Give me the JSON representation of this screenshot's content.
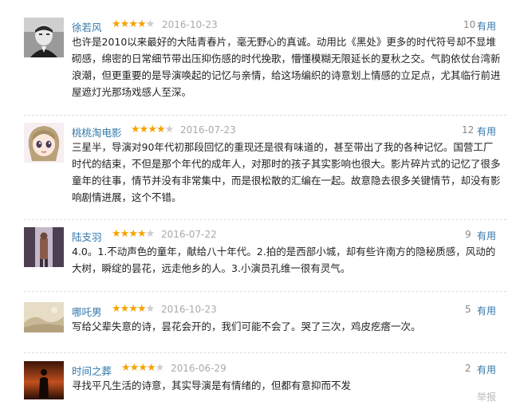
{
  "reviews": [
    {
      "author": "徐若风",
      "rating": 4,
      "date": "2016-10-23",
      "votes": "10",
      "useful_label": "有用",
      "text": "也许是2010以来最好的大陆青春片，毫无野心的真诚。动用比《黑处》更多的时代符号却不显堆砌感，绵密的日常细节带出压抑伤感的时代挽歌，懵懂模糊无限延长的夏秋之交。气韵依仗台湾新浪潮，但更重要的是导演唤起的记忆与亲情，给这场编织的诗意划上情感的立足点，尤其临行前进屋遮灯光那场戏感人至深。",
      "avatar_icon": "boy-portrait"
    },
    {
      "author": "桃桃淘电影",
      "rating": 4,
      "date": "2016-07-23",
      "votes": "12",
      "useful_label": "有用",
      "text": "三星半，导演对90年代初那段回忆的重现还是很有味道的，甚至带出了我的各种记忆。国营工厂时代的结束，不但是那个年代的成年人，对那时的孩子其实影响也很大。影片碎片式的记忆了很多童年的往事，情节并没有非常集中，而是很松散的汇编在一起。故意隐去很多关键情节，却没有影响剧情进展，这个不错。",
      "avatar_icon": "anime-girl"
    },
    {
      "author": "陆支羽",
      "rating": 4,
      "date": "2016-07-22",
      "votes": "9",
      "useful_label": "有用",
      "text": "4.0。1.不动声色的童年，献给八十年代。2.拍的是西部小城，却有些许南方的隐秘质感，风动的大树，瞬绽的昙花，远走他乡的人。3.小演员孔维一很有灵气。",
      "avatar_icon": "doorway-photo"
    },
    {
      "author": "哪吒男",
      "rating": 4,
      "date": "2016-10-23",
      "votes": "5",
      "useful_label": "有用",
      "text": "写给父辈失意的诗，昙花会开的，我们可能不会了。哭了三次，鸡皮疙瘩一次。",
      "avatar_icon": "landscape"
    },
    {
      "author": "时间之葬",
      "rating": 4,
      "date": "2016-06-29",
      "votes": "2",
      "useful_label": "有用",
      "text": "寻找平凡生活的诗意，其实导演是有情绪的，但都有意抑而不发",
      "avatar_icon": "silhouette-sunset"
    }
  ],
  "report_label": "举报",
  "colors": {
    "link": "#3377aa",
    "star": "#f4a300",
    "date": "#aaaaaa"
  }
}
